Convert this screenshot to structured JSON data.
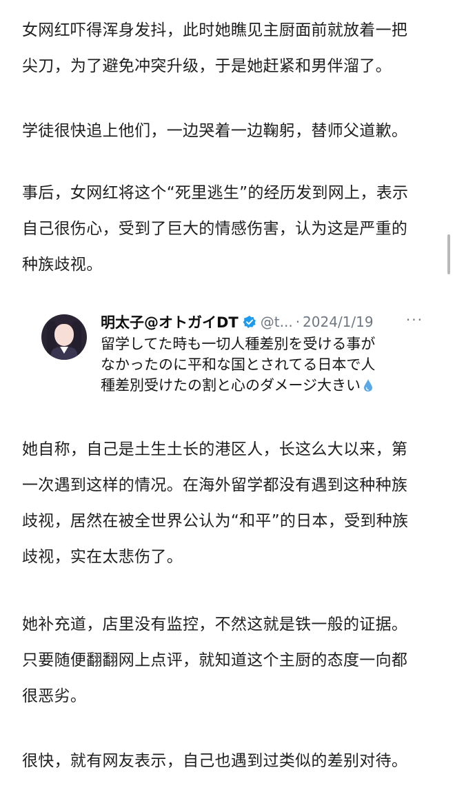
{
  "paragraph_1": {
    "lines": [
      "女网红吓得浑身发抖，此时她瞧见主厨面前就放着一把",
      "尖刀，为了避免冲突升级，于是她赶紧和男伴溜了。"
    ]
  },
  "paragraph_2": {
    "lines": [
      "学徒很快追上他们，一边哭着一边鞠躬，替师父道歉。"
    ]
  },
  "paragraph_3": {
    "lines": [
      "事后，女网红将这个“死里逃生”的经历发到网上，表示",
      "自己很伤心，受到了巨大的情感伤害，认为这是严重的",
      "种族歧视。"
    ]
  },
  "tweet": {
    "author_name": "明太子@オトガイDT",
    "handle": "@t...",
    "separator": "·",
    "date": "2024/1/19",
    "more": "···",
    "verified_icon": "verified-badge-icon",
    "emoji_icon": "droplet-icon",
    "body_lines": [
      "留学してた時も一切人種差別を受ける事が",
      "なかったのに平和な国とされてる日本で人",
      "種差別受けたの割と心のダメージ大きい"
    ]
  },
  "paragraph_4": {
    "lines": [
      "她自称，自己是土生土长的港区人，长这么大以来，第",
      "一次遇到这样的情况。在海外留学都没有遇到这种种族",
      "歧视，居然在被全世界公认为“和平”的日本，受到种族",
      "歧视，实在太悲伤了。"
    ]
  },
  "paragraph_5": {
    "lines": [
      "她补充道，店里没有监控，不然这就是铁一般的证据。",
      "只要随便翻翻网上点评，就知道这个主厨的态度一向都",
      "很恶劣。"
    ]
  },
  "paragraph_6": {
    "lines": [
      "很快，就有网友表示，自己也遇到过类似的差别对待。"
    ]
  },
  "colors": {
    "text": "#1f1f1f",
    "secondary": "#6f7780",
    "verified": "#1d9bf0",
    "droplet": "#5aa9e6"
  }
}
